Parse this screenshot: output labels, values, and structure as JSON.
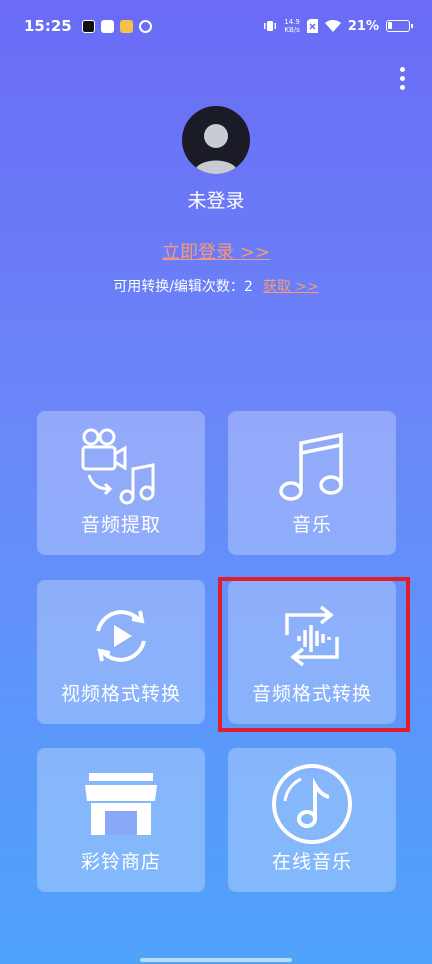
{
  "status_bar": {
    "time": "15:25",
    "net_speed_value": "14.9",
    "net_speed_unit": "KB/s",
    "battery": "21%"
  },
  "profile": {
    "username": "未登录",
    "login_link": "立即登录 >>",
    "quota_label": "可用转换/编辑次数：",
    "quota_count": "2",
    "get_link": "获取 >>"
  },
  "tiles": [
    {
      "label": "音频提取",
      "icon": "video-to-music-icon"
    },
    {
      "label": "音乐",
      "icon": "music-note-icon"
    },
    {
      "label": "视频格式转换",
      "icon": "video-convert-icon"
    },
    {
      "label": "音频格式转换",
      "icon": "audio-convert-icon"
    },
    {
      "label": "彩铃商店",
      "icon": "store-icon"
    },
    {
      "label": "在线音乐",
      "icon": "music-disc-icon"
    }
  ],
  "highlight_color": "#e01e2b",
  "link_color": "#f59a7a"
}
